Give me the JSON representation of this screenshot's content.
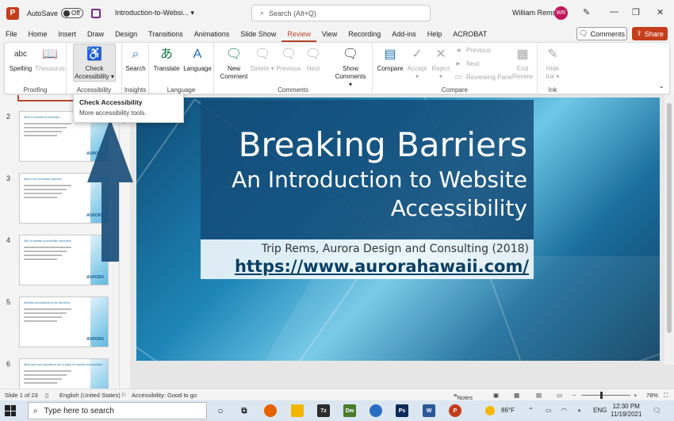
{
  "titlebar": {
    "autosave_label": "AutoSave",
    "autosave_state": "Off",
    "doc_title": "Introduction-to-Websi...",
    "search_placeholder": "Search (Alt+Q)",
    "user_name": "William Rems",
    "user_initials": "WR"
  },
  "tabs": [
    "File",
    "Home",
    "Insert",
    "Draw",
    "Design",
    "Transitions",
    "Animations",
    "Slide Show",
    "Review",
    "View",
    "Recording",
    "Add-ins",
    "Help",
    "ACROBAT"
  ],
  "active_tab": "Review",
  "comments_label": "Comments",
  "share_label": "Share",
  "ribbon": {
    "proofing": {
      "label": "Proofing",
      "spelling": "Spelling",
      "thesaurus": "Thesaurus",
      "spelling_icon_text": "abc"
    },
    "accessibility": {
      "label": "Accessibility",
      "check_line1": "Check",
      "check_line2": "Accessibility"
    },
    "insights": {
      "label": "Insights",
      "search": "Search"
    },
    "language": {
      "label": "Language",
      "translate": "Translate",
      "language": "Language"
    },
    "comments": {
      "label": "Comments",
      "new_line1": "New",
      "new_line2": "Comment",
      "delete": "Delete",
      "previous": "Previous",
      "next": "Next",
      "show_line1": "Show",
      "show_line2": "Comments"
    },
    "compare": {
      "label": "Compare",
      "compare": "Compare",
      "accept": "Accept",
      "reject": "Reject",
      "previous": "Previous",
      "next": "Next",
      "reviewing_pane": "Reviewing Pane",
      "end_line1": "End",
      "end_line2": "Review"
    },
    "ink": {
      "label": "Ink",
      "hide_line1": "Hide",
      "hide_line2": "Ink"
    }
  },
  "tooltip": {
    "title": "Check Accessibility",
    "description": "More accessibility tools."
  },
  "thumbnails": [
    {
      "num": "2",
      "title": "What is website accessibility?"
    },
    {
      "num": "3",
      "title": "What is an accessible website?"
    },
    {
      "num": "4",
      "title": "Why is website accessibility important?"
    },
    {
      "num": "5",
      "title": "Website Accessibility by the Numbers"
    },
    {
      "num": "6",
      "title": "What laws and regulations are in place for website accessibility?"
    }
  ],
  "thumb_logo": "AURORA",
  "slide": {
    "title": "Breaking Barriers",
    "subtitle_line1": "An Introduction to Website",
    "subtitle_line2": "Accessibility",
    "author": "Trip Rems, Aurora Design and Consulting (2018)",
    "url": "https://www.aurorahawaii.com/"
  },
  "statusbar": {
    "slide_info": "Slide 1 of 23",
    "language": "English (United States)",
    "accessibility": "Accessibility: Good to go",
    "notes": "Notes",
    "zoom": "78%"
  },
  "taskbar": {
    "search_placeholder": "Type here to search",
    "weather": "86°F",
    "lang": "ENG",
    "time": "12:30 PM",
    "date": "11/19/2021"
  },
  "colors": {
    "accent": "#b7472a",
    "share": "#c43e1c",
    "slide_blue": "#144b78",
    "arrow_blue": "#1b4f7a"
  }
}
